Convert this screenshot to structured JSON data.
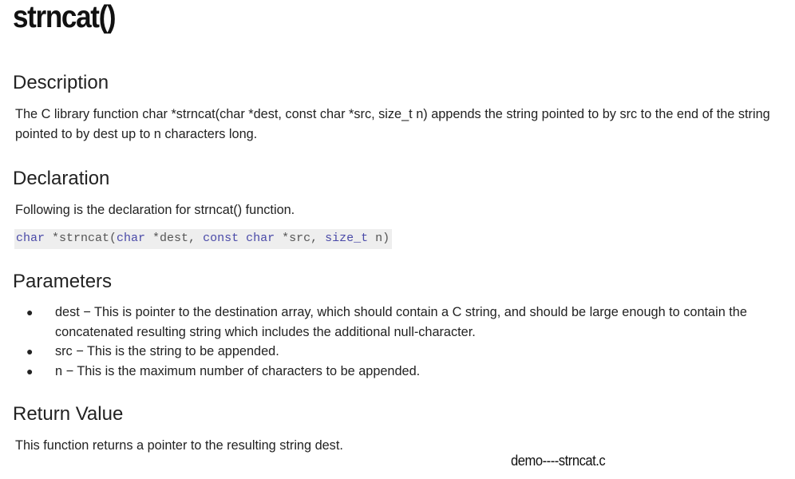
{
  "title": "strncat()",
  "sections": {
    "description": {
      "heading": "Description",
      "text": "The C library function char *strncat(char *dest, const char *src, size_t n) appends the string pointed to by src to the end of the string pointed to by dest up to n characters long."
    },
    "declaration": {
      "heading": "Declaration",
      "text": "Following is the declaration for strncat() function.",
      "code": {
        "kw1": "char",
        "t1": " *strncat(",
        "kw2": "char",
        "t2": " *dest, ",
        "kw3": "const",
        "t3": " ",
        "kw4": "char",
        "t4": " *src, ",
        "kw5": "size_t",
        "t5": " n)"
      }
    },
    "parameters": {
      "heading": "Parameters",
      "items": [
        "dest − This is pointer to the destination array, which should contain a C string, and should be large enough to contain the concatenated resulting string which includes the additional null-character.",
        "src − This is the string to be appended.",
        "n − This is the maximum number of characters to be appended."
      ],
      "bullet": "●"
    },
    "return_value": {
      "heading": "Return Value",
      "text": "This function returns a pointer to the resulting string dest."
    }
  },
  "caption": "demo----strncat.c",
  "colors": {
    "code_background": "#eeeeee",
    "code_keyword": "#4a4aa8"
  }
}
